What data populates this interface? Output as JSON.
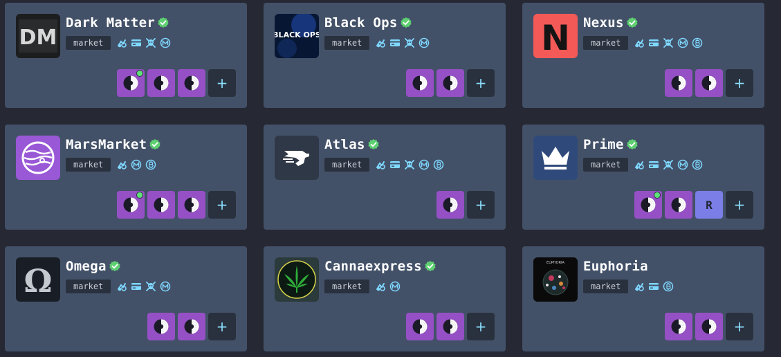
{
  "colors": {
    "background": "#262834",
    "card": "#435168",
    "tag": "#2a313e",
    "verified": "#5fd072",
    "feature": "#7fd8ff",
    "tor": "#9650c5",
    "online": "#5fe07a"
  },
  "cards": [
    {
      "name": "Dark Matter",
      "tag": "market",
      "verified": true,
      "logo": "dark-matter-logo",
      "logo_text": "DM",
      "features": [
        "escrow-icon",
        "card-icon",
        "skull-icon",
        "monero-icon"
      ],
      "mirrors": 3,
      "online": true,
      "extra": null,
      "add_label": "+"
    },
    {
      "name": "Black Ops",
      "tag": "market",
      "verified": true,
      "logo": "black-ops-logo",
      "logo_text": "BLACK OPS",
      "features": [
        "escrow-icon",
        "card-icon",
        "skull-icon",
        "monero-icon"
      ],
      "mirrors": 2,
      "online": false,
      "extra": null,
      "add_label": "+"
    },
    {
      "name": "Nexus",
      "tag": "market",
      "verified": true,
      "logo": "nexus-logo",
      "logo_text": "N",
      "features": [
        "escrow-icon",
        "card-icon",
        "skull-icon",
        "monero-icon",
        "bitcoin-icon"
      ],
      "mirrors": 2,
      "online": false,
      "extra": null,
      "add_label": "+"
    },
    {
      "name": "MarsMarket",
      "tag": "market",
      "verified": true,
      "logo": "mars-logo",
      "logo_text": "",
      "features": [
        "escrow-icon",
        "monero-icon",
        "bitcoin-icon"
      ],
      "mirrors": 3,
      "online": true,
      "extra": null,
      "add_label": "+"
    },
    {
      "name": "Atlas",
      "tag": "market",
      "verified": true,
      "logo": "atlas-logo",
      "logo_text": "",
      "features": [
        "escrow-icon",
        "card-icon",
        "skull-icon",
        "monero-icon",
        "bitcoin-icon"
      ],
      "mirrors": 1,
      "online": false,
      "extra": null,
      "add_label": "+"
    },
    {
      "name": "Prime",
      "tag": "market",
      "verified": true,
      "logo": "prime-logo",
      "logo_text": "",
      "features": [
        "escrow-icon",
        "card-icon",
        "skull-icon",
        "monero-icon",
        "bitcoin-icon"
      ],
      "mirrors": 2,
      "online": true,
      "extra": "R",
      "add_label": "+"
    },
    {
      "name": "Omega",
      "tag": "market",
      "verified": true,
      "logo": "omega-logo",
      "logo_text": "Ω",
      "features": [
        "escrow-icon",
        "card-icon",
        "skull-icon",
        "monero-icon"
      ],
      "mirrors": 2,
      "online": false,
      "extra": null,
      "add_label": "+"
    },
    {
      "name": "Cannaexpress",
      "tag": "market",
      "verified": true,
      "logo": "cannaexpress-logo",
      "logo_text": "",
      "features": [
        "escrow-icon",
        "monero-icon"
      ],
      "mirrors": 2,
      "online": false,
      "extra": null,
      "add_label": "+"
    },
    {
      "name": "Euphoria",
      "tag": "market",
      "verified": false,
      "logo": "euphoria-logo",
      "logo_text": "EUPHORIA",
      "features": [
        "escrow-icon",
        "card-icon",
        "bitcoin-icon"
      ],
      "mirrors": 2,
      "online": false,
      "extra": null,
      "add_label": "+"
    }
  ]
}
